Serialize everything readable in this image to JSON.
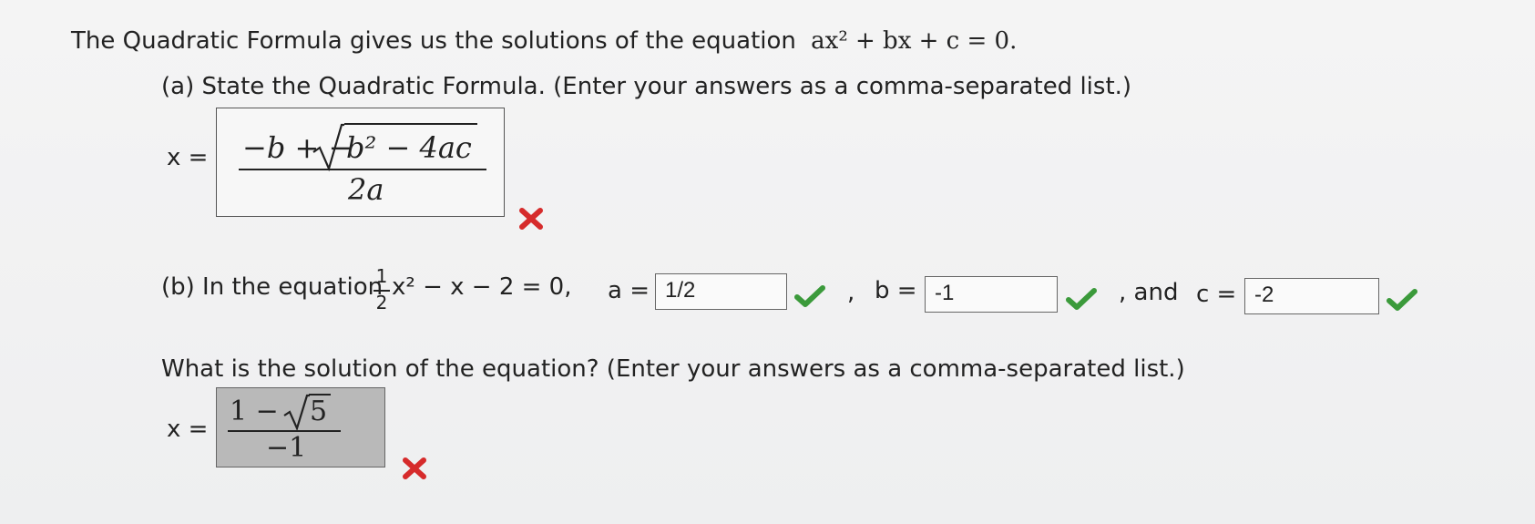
{
  "intro": {
    "text": "The Quadratic Formula gives us the solutions of the equation",
    "equation": "ax² + bx + c = 0."
  },
  "part_a": {
    "prompt": "(a) State the Quadratic Formula. (Enter your answers as a comma-separated list.)",
    "x_label": "x =",
    "answer_numerator_prefix": "−b + −",
    "answer_radicand": "b² − 4ac",
    "answer_denominator": "2a",
    "status": "incorrect",
    "status_color": "#d62b2b"
  },
  "part_b": {
    "prefix": "(b) In the equation",
    "frac_num": "1",
    "frac_den": "2",
    "equation_rest": "x² − x − 2 = 0,",
    "a_label": "a =",
    "a_value": "1/2",
    "sep1": ",",
    "b_label": "b =",
    "b_value": "-1",
    "sep2": ", and",
    "c_label": "c =",
    "c_value": "-2",
    "status_color": "#3b9a3b"
  },
  "solution": {
    "prompt": "What is the solution of the equation? (Enter your answers as a comma-separated list.)",
    "x_label": "x =",
    "numerator_prefix": "1 − ",
    "radicand": "5",
    "denominator": "−1",
    "status": "incorrect"
  }
}
